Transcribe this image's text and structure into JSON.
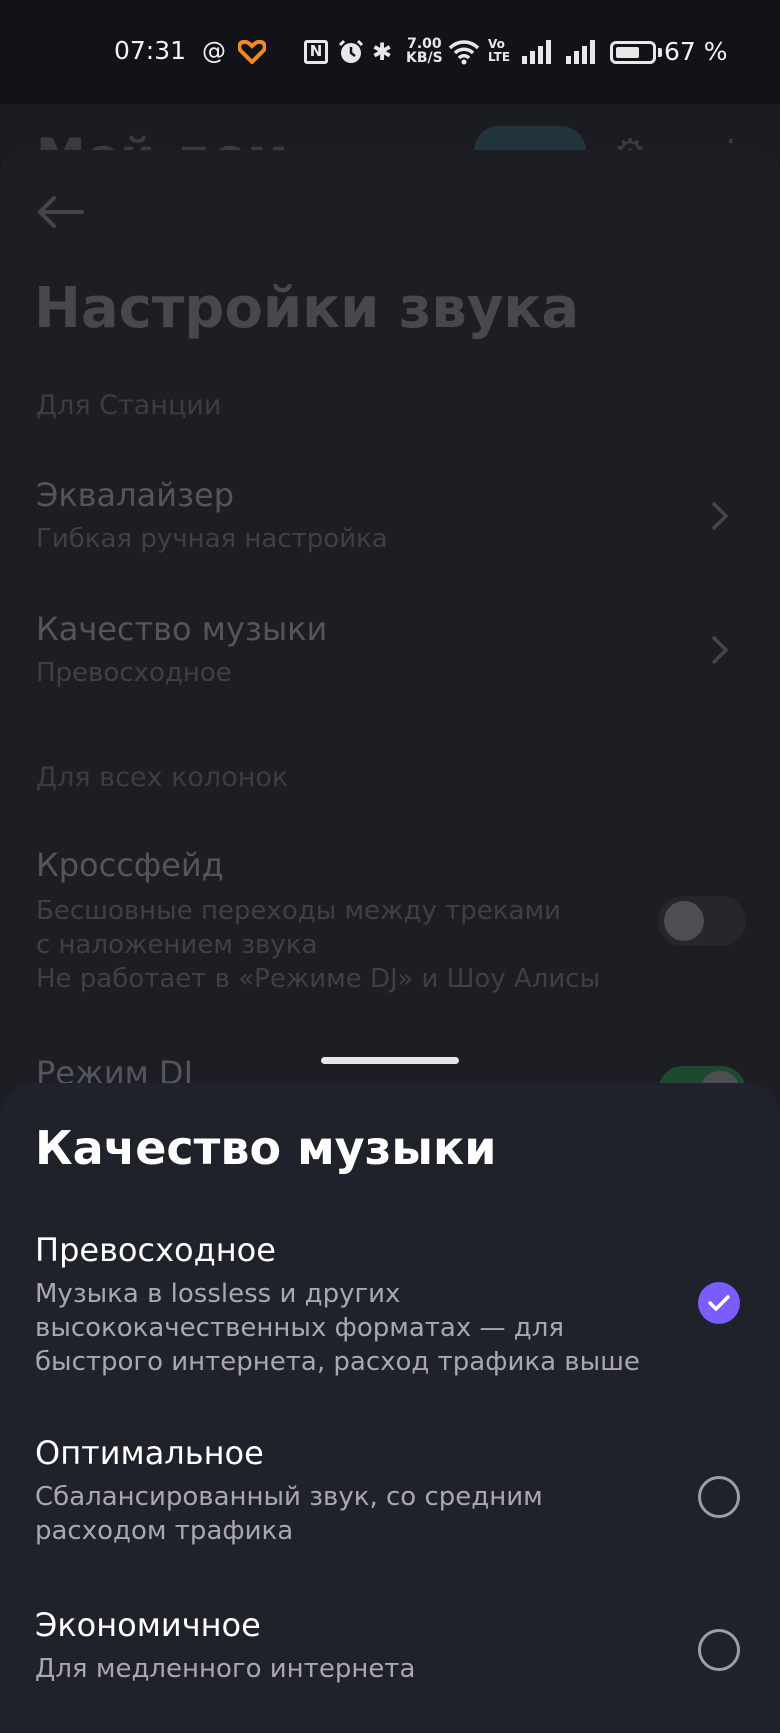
{
  "status_bar": {
    "time": "07:31",
    "at_symbol": "@",
    "speed_value": "7.00",
    "speed_unit": "KB/S",
    "volte_top": "Vo",
    "volte_bottom": "LTE",
    "battery_percent": "67 %",
    "battery_level": 0.67,
    "icons": [
      "heart-app-icon",
      "nfc-icon",
      "alarm-icon",
      "bluetooth-icon",
      "wifi-icon",
      "signal-icon",
      "battery-icon"
    ]
  },
  "background_screen": {
    "partial_title": "Мой дом",
    "back_label": "Назад",
    "title": "Настройки звука",
    "section_station": "Для Станции",
    "equalizer": {
      "title": "Эквалайзер",
      "subtitle": "Гибкая ручная настройка"
    },
    "music_quality": {
      "title": "Качество музыки",
      "subtitle": "Превосходное"
    },
    "section_all_speakers": "Для всех колонок",
    "crossfade": {
      "title": "Кроссфейд",
      "subtitle_line1": "Бесшовные переходы между треками",
      "subtitle_line2": "с наложением звука",
      "subtitle_line3": "Не работает в «Режиме DJ» и Шоу Алисы",
      "enabled": false
    },
    "dj_mode": {
      "title": "Режим DJ",
      "enabled": true
    }
  },
  "sheet": {
    "title": "Качество музыки",
    "options": [
      {
        "title": "Превосходное",
        "description": "Музыка в lossless и других\nвысококачественных форматах — для\nбыстрого интернета, расход трафика выше",
        "selected": true
      },
      {
        "title": "Оптимальное",
        "description": "Сбалансированный звук, со средним\nрасходом трафика",
        "selected": false
      },
      {
        "title": "Экономичное",
        "description": "Для медленного интернета",
        "selected": false
      }
    ]
  },
  "colors": {
    "accent": "#7b5cff",
    "sheet_bg": "#1f212b",
    "screen_bg": "#121318",
    "toggle_on": "#1d4a2e"
  }
}
